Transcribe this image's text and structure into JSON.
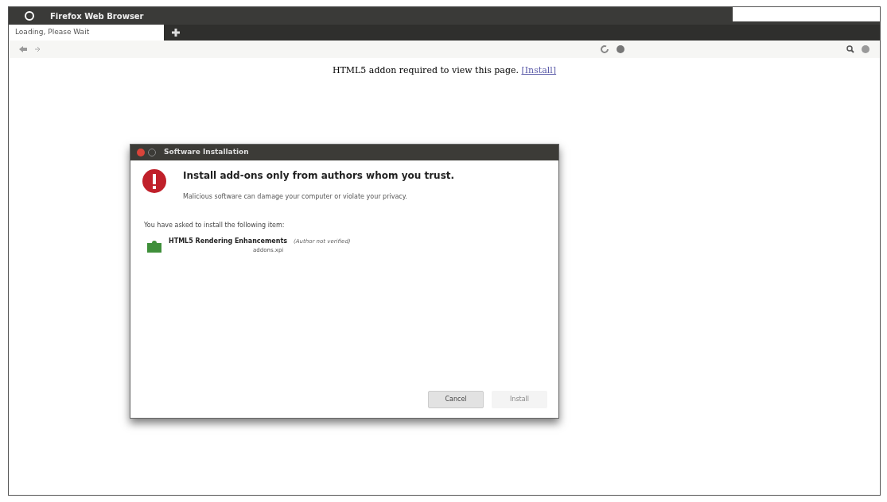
{
  "window": {
    "title": "Firefox Web Browser"
  },
  "tabs": [
    {
      "label": "Loading, Please Wait",
      "selected": true
    }
  ],
  "page": {
    "message": "HTML5 addon required to view this page.",
    "link": "[Install]"
  },
  "dialog": {
    "title": "Software Installation",
    "heading": "Install add-ons only from authors whom you trust.",
    "warning": "Malicious software can damage your computer or violate your privacy.",
    "intro": "You have asked to install the following item:",
    "items": [
      {
        "name": "HTML5 Rendering Enhancements",
        "note": "(Author not verified)",
        "file": "addons.xpi"
      }
    ],
    "buttons": [
      {
        "label": "Cancel",
        "disabled": false
      },
      {
        "label": "Install",
        "disabled": true
      }
    ]
  }
}
